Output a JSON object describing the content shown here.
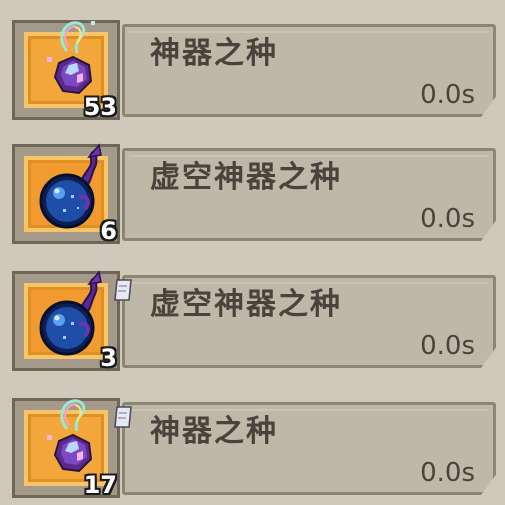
{
  "items": [
    {
      "name": "神器之种",
      "count": "53",
      "time": "0.0s",
      "icon": "artifact-seed-icon",
      "has_tag": false
    },
    {
      "name": "虚空神器之种",
      "count": "6",
      "time": "0.0s",
      "icon": "void-artifact-seed-icon",
      "has_tag": false
    },
    {
      "name": "虚空神器之种",
      "count": "3",
      "time": "0.0s",
      "icon": "void-artifact-seed-icon",
      "has_tag": true
    },
    {
      "name": "神器之种",
      "count": "17",
      "time": "0.0s",
      "icon": "artifact-seed-icon",
      "has_tag": true
    }
  ],
  "colors": {
    "background": "#cfc8bb",
    "bar": "#bfb7a8",
    "slot_frame": "#f3a63a",
    "text": "#4a433b"
  }
}
